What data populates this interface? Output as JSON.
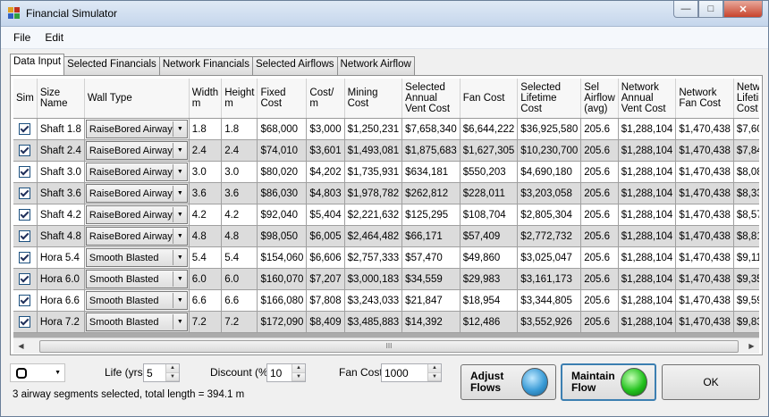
{
  "window": {
    "title": "Financial Simulator",
    "min": "—",
    "max": "□",
    "close": "✕"
  },
  "menu": [
    "File",
    "Edit"
  ],
  "tabs": [
    "Data Input",
    "Selected Financials",
    "Network Financials",
    "Selected Airflows",
    "Network Airflow"
  ],
  "grid": {
    "columns": [
      "Sim",
      "Size Name",
      "Wall Type",
      "Width m",
      "Height m",
      "Fixed Cost",
      "Cost/ m",
      "Mining Cost",
      "Selected Annual Vent Cost",
      "Fan Cost",
      "Selected Lifetime Cost",
      "Sel Airflow (avg)",
      "Network Annual Vent Cost",
      "Network Fan Cost",
      "Network Lifetime Cost"
    ],
    "rows": [
      [
        "Shaft 1.8",
        "RaiseBored Airway",
        "1.8",
        "1.8",
        "$68,000",
        "$3,000",
        "$1,250,231",
        "$7,658,340",
        "$6,644,222",
        "$36,925,580",
        "205.6",
        "$1,288,104",
        "$1,470,438",
        "$7,60"
      ],
      [
        "Shaft 2.4",
        "RaiseBored Airway",
        "2.4",
        "2.4",
        "$74,010",
        "$3,601",
        "$1,493,081",
        "$1,875,683",
        "$1,627,305",
        "$10,230,700",
        "205.6",
        "$1,288,104",
        "$1,470,438",
        "$7,84"
      ],
      [
        "Shaft 3.0",
        "RaiseBored Airway",
        "3.0",
        "3.0",
        "$80,020",
        "$4,202",
        "$1,735,931",
        "$634,181",
        "$550,203",
        "$4,690,180",
        "205.6",
        "$1,288,104",
        "$1,470,438",
        "$8,08"
      ],
      [
        "Shaft 3.6",
        "RaiseBored Airway",
        "3.6",
        "3.6",
        "$86,030",
        "$4,803",
        "$1,978,782",
        "$262,812",
        "$228,011",
        "$3,203,058",
        "205.6",
        "$1,288,104",
        "$1,470,438",
        "$8,33"
      ],
      [
        "Shaft 4.2",
        "RaiseBored Airway",
        "4.2",
        "4.2",
        "$92,040",
        "$5,404",
        "$2,221,632",
        "$125,295",
        "$108,704",
        "$2,805,304",
        "205.6",
        "$1,288,104",
        "$1,470,438",
        "$8,57"
      ],
      [
        "Shaft 4.8",
        "RaiseBored Airway",
        "4.8",
        "4.8",
        "$98,050",
        "$6,005",
        "$2,464,482",
        "$66,171",
        "$57,409",
        "$2,772,732",
        "205.6",
        "$1,288,104",
        "$1,470,438",
        "$8,81"
      ],
      [
        "Hora 5.4",
        "Smooth Blasted",
        "5.4",
        "5.4",
        "$154,060",
        "$6,606",
        "$2,757,333",
        "$57,470",
        "$49,860",
        "$3,025,047",
        "205.6",
        "$1,288,104",
        "$1,470,438",
        "$9,11"
      ],
      [
        "Hora 6.0",
        "Smooth Blasted",
        "6.0",
        "6.0",
        "$160,070",
        "$7,207",
        "$3,000,183",
        "$34,559",
        "$29,983",
        "$3,161,173",
        "205.6",
        "$1,288,104",
        "$1,470,438",
        "$9,35"
      ],
      [
        "Hora 6.6",
        "Smooth Blasted",
        "6.6",
        "6.6",
        "$166,080",
        "$7,808",
        "$3,243,033",
        "$21,847",
        "$18,954",
        "$3,344,805",
        "205.6",
        "$1,288,104",
        "$1,470,438",
        "$9,59"
      ],
      [
        "Hora 7.2",
        "Smooth Blasted",
        "7.2",
        "7.2",
        "$172,090",
        "$8,409",
        "$3,485,883",
        "$14,392",
        "$12,486",
        "$3,552,926",
        "205.6",
        "$1,288,104",
        "$1,470,438",
        "$9,83"
      ]
    ]
  },
  "scrollbar": {
    "left": "◀",
    "right": "▶",
    "grip": "III"
  },
  "controls": {
    "life_label": "Life (yrs)",
    "life_value": "5",
    "discount_label": "Discount (%)",
    "discount_value": "10",
    "fan_cost_label": "Fan Cost",
    "fan_cost_value": "1000",
    "status": "3 airway segments selected, total length = 394.1 m",
    "adjust_flows": "Adjust Flows",
    "maintain_flow": "Maintain Flow",
    "ok": "OK"
  },
  "colors": {
    "titlebar": "#c5d6ec",
    "led_blue": "#3a9bd6",
    "led_green": "#23c21e",
    "focus": "#3c7fb1"
  }
}
